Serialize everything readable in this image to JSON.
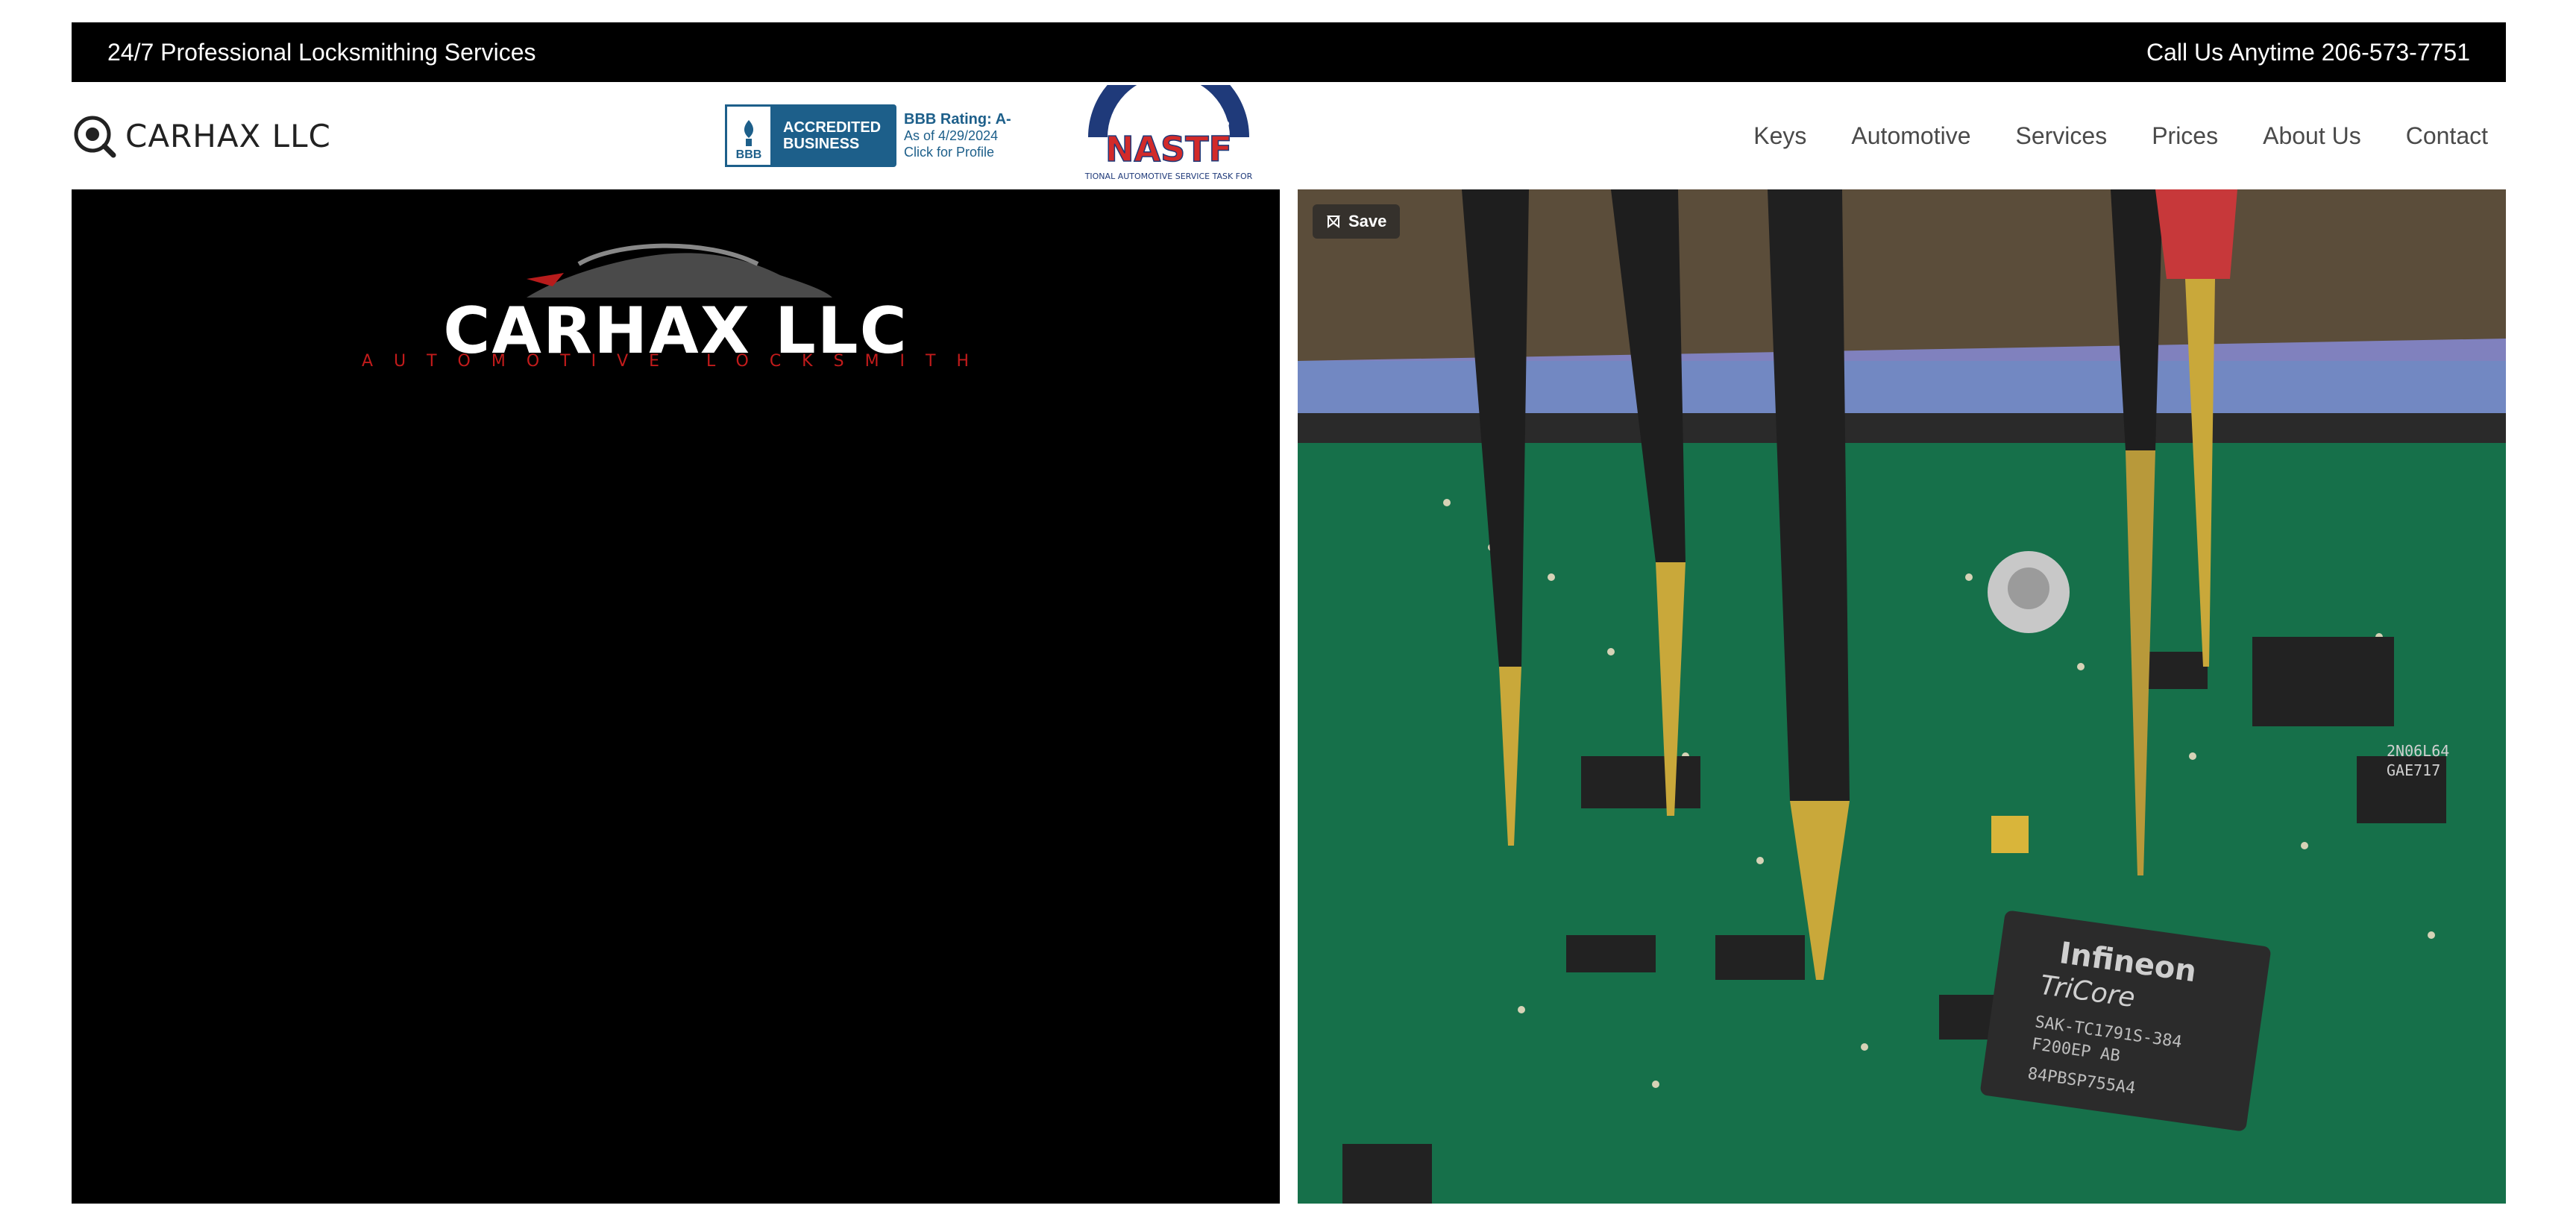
{
  "topbar": {
    "tagline": "24/7 Professional Locksmithing Services",
    "phone": "Call Us Anytime 206-573-7751"
  },
  "brand": {
    "name": "CARHAX LLC",
    "icon": "magnifier-key-icon"
  },
  "bbb": {
    "accredited_line1": "ACCREDITED",
    "accredited_line2": "BUSINESS",
    "seal": "BBB",
    "rating": "BBB Rating: A-",
    "as_of": "As of 4/29/2024",
    "click": "Click for Profile"
  },
  "nastf": {
    "label": "NASTF",
    "arc_text": "TIONAL AUTOMOTIVE SERVICE TASK FOR"
  },
  "nav": {
    "items": [
      {
        "label": "Keys"
      },
      {
        "label": "Automotive"
      },
      {
        "label": "Services"
      },
      {
        "label": "Prices"
      },
      {
        "label": "About Us"
      },
      {
        "label": "Contact"
      }
    ]
  },
  "hero_left": {
    "logo_title": "CARHAX LLC",
    "logo_subtitle": "AUTOMOTIVE LOCKSMITH"
  },
  "hero_right": {
    "save_label": "Save",
    "chip_brand": "Infineon",
    "chip_model": "TriCore",
    "chip_line1": "SAK-TC1791S-384",
    "chip_line2": "F200EP AB",
    "chip_line3": "84PBSP755A4",
    "chip2_line1": "2N06L64",
    "chip2_line2": "GAE717"
  },
  "colors": {
    "topbar_bg": "#000000",
    "accent_red": "#c21b1b",
    "bbb_blue": "#1d5f8a",
    "pcb_green": "#1b6b49"
  }
}
